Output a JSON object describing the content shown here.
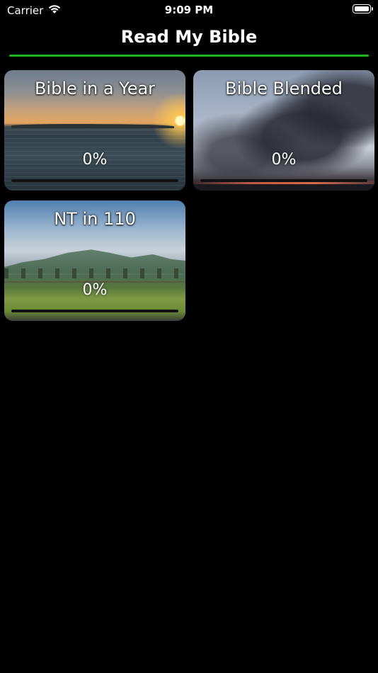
{
  "status_bar": {
    "carrier": "Carrier",
    "time": "9:09 PM",
    "icons": [
      "wifi-icon",
      "battery-icon"
    ]
  },
  "nav": {
    "title": "Read My Bible",
    "accent_color": "#1db31d"
  },
  "plans": [
    {
      "title": "Bible in a Year",
      "percent_label": "0%",
      "progress": 0,
      "image": "sunset-sea"
    },
    {
      "title": "Bible Blended",
      "percent_label": "0%",
      "progress": 0,
      "image": "cloudy-sky"
    },
    {
      "title": "NT in 110",
      "percent_label": "0%",
      "progress": 0,
      "image": "mountain-field"
    }
  ]
}
